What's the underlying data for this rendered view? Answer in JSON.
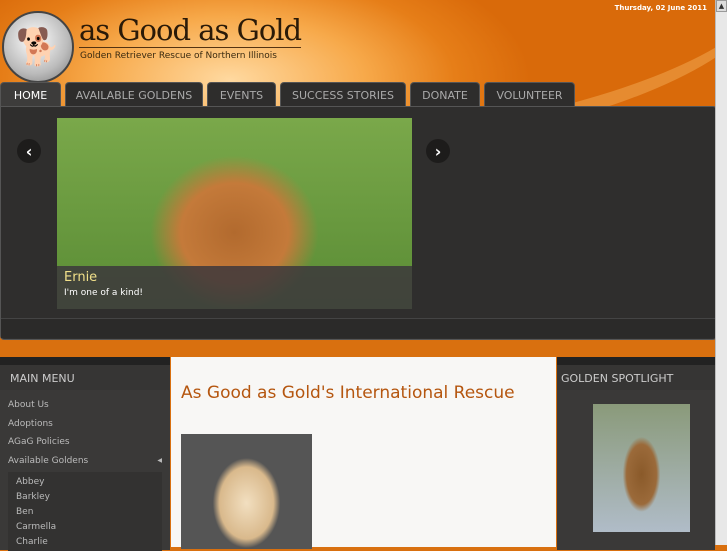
{
  "header": {
    "date": "Thursday, 02 June 2011",
    "logo_title": "as Good as Gold",
    "logo_subtitle": "Golden Retriever Rescue of Northern Illinois"
  },
  "nav": {
    "tabs": [
      "HOME",
      "AVAILABLE GOLDENS",
      "EVENTS",
      "SUCCESS STORIES",
      "DONATE",
      "VOLUNTEER"
    ]
  },
  "slider": {
    "name": "Ernie",
    "caption": "I'm one of a kind!",
    "prev": "‹",
    "next": "›"
  },
  "left": {
    "title": "MAIN MENU",
    "items": [
      "About Us",
      "Adoptions",
      "AGaG Policies",
      "Available Goldens"
    ],
    "sub_items": [
      "Abbey",
      "Barkley",
      "Ben",
      "Carmella",
      "Charlie"
    ]
  },
  "main": {
    "title": "As Good as Gold's International Rescue"
  },
  "right": {
    "title": "GOLDEN SPOTLIGHT"
  }
}
